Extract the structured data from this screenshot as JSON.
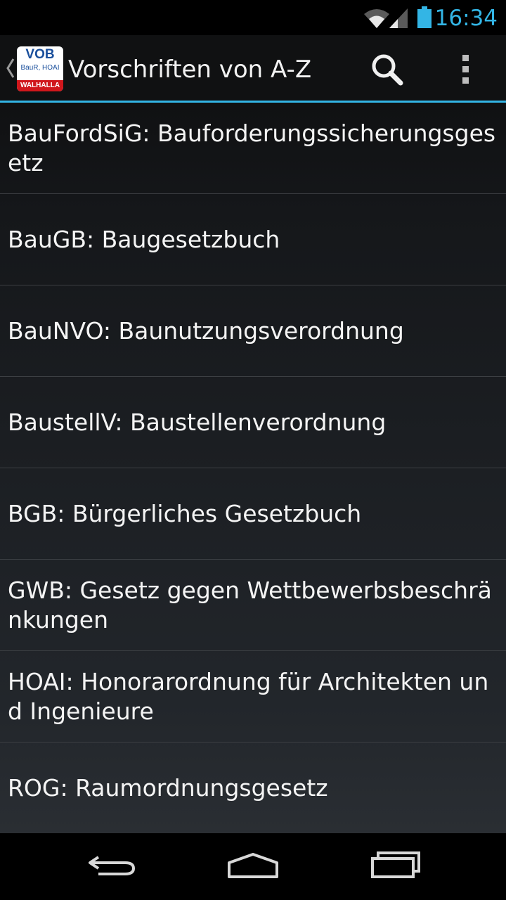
{
  "status_bar": {
    "time": "16:34",
    "icons": [
      "wifi-icon",
      "signal-icon",
      "battery-icon"
    ],
    "accent_color": "#33b5e5"
  },
  "action_bar": {
    "app_logo": {
      "line1": "VOB",
      "line2": "BauR, HOAI",
      "band": "WALHALLA"
    },
    "title": "Vorschriften von A-Z",
    "actions": [
      "search-icon",
      "overflow-menu-icon"
    ],
    "divider_color": "#33b5e5"
  },
  "laws": [
    {
      "label": "BauFordSiG: Bauforderungssicherungsgesetz"
    },
    {
      "label": "BauGB: Baugesetzbuch"
    },
    {
      "label": "BauNVO: Baunutzungsverordnung"
    },
    {
      "label": "BaustellV: Baustellenverordnung"
    },
    {
      "label": "BGB: Bürgerliches Gesetzbuch"
    },
    {
      "label": "GWB: Gesetz gegen Wettbewerbsbeschränkungen"
    },
    {
      "label": "HOAI: Honorarordnung für Architekten und Ingenieure"
    },
    {
      "label": "ROG: Raumordnungsgesetz"
    }
  ],
  "nav_bar": {
    "buttons": [
      "back-icon",
      "home-icon",
      "recents-icon"
    ]
  }
}
